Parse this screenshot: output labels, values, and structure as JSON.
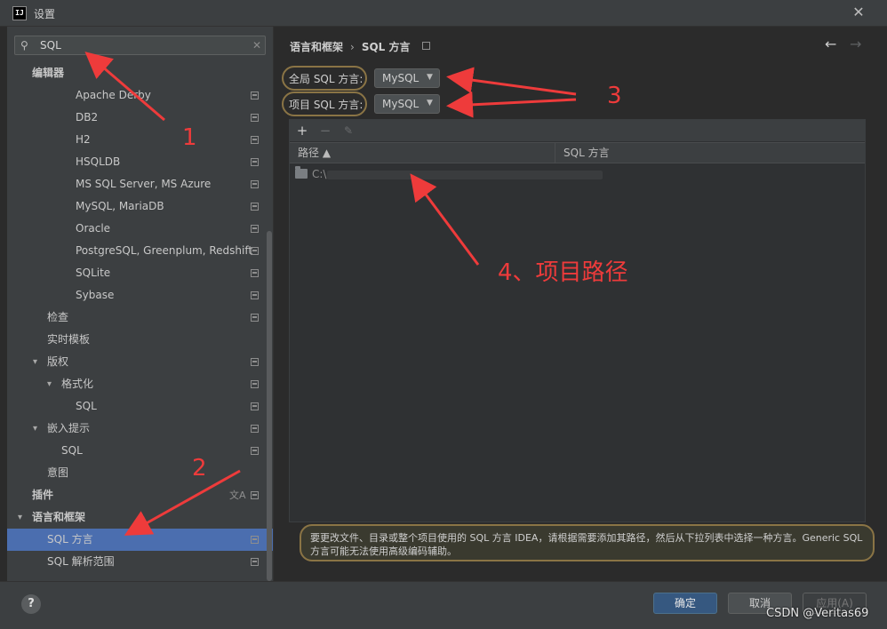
{
  "window": {
    "title": "设置",
    "app_icon_text": "IJ"
  },
  "search": {
    "value": "SQL"
  },
  "tree": [
    {
      "label": "编辑器",
      "indent": 28,
      "bold": true
    },
    {
      "label": "Apache Derby",
      "indent": 77,
      "project": true
    },
    {
      "label": "DB2",
      "indent": 77,
      "project": true
    },
    {
      "label": "H2",
      "indent": 77,
      "project": true
    },
    {
      "label": "HSQLDB",
      "indent": 77,
      "project": true
    },
    {
      "label": "MS SQL Server, MS Azure",
      "indent": 77,
      "project": true
    },
    {
      "label": "MySQL, MariaDB",
      "indent": 77,
      "project": true
    },
    {
      "label": "Oracle",
      "indent": 77,
      "project": true
    },
    {
      "label": "PostgreSQL, Greenplum, Redshift",
      "indent": 77,
      "project": true
    },
    {
      "label": "SQLite",
      "indent": 77,
      "project": true
    },
    {
      "label": "Sybase",
      "indent": 77,
      "project": true
    },
    {
      "label": "检查",
      "indent": 45,
      "project": true
    },
    {
      "label": "实时模板",
      "indent": 45
    },
    {
      "label": "版权",
      "indent": 45,
      "chevron": true,
      "project": true
    },
    {
      "label": "格式化",
      "indent": 61,
      "chevron": true,
      "project": true
    },
    {
      "label": "SQL",
      "indent": 77,
      "project": true
    },
    {
      "label": "嵌入提示",
      "indent": 45,
      "chevron": true,
      "project": true
    },
    {
      "label": "SQL",
      "indent": 61,
      "project": true
    },
    {
      "label": "意图",
      "indent": 45
    },
    {
      "label": "插件",
      "indent": 28,
      "bold": true,
      "project": true,
      "translate": true
    },
    {
      "label": "语言和框架",
      "indent": 28,
      "bold": true,
      "chevron": true
    },
    {
      "label": "SQL 方言",
      "indent": 45,
      "project": true,
      "selected": true
    },
    {
      "label": "SQL 解析范围",
      "indent": 45,
      "project": true
    }
  ],
  "breadcrumb": {
    "parent": "语言和框架",
    "separator": "›",
    "current": "SQL 方言"
  },
  "dialects": {
    "global_label": "全局 SQL 方言:",
    "global_value": "MySQL",
    "project_label": "项目 SQL 方言:",
    "project_value": "MySQL"
  },
  "table": {
    "toolbar": {
      "add": "+",
      "remove": "−",
      "edit": "✎"
    },
    "columns": [
      "路径 ▲",
      "SQL 方言"
    ],
    "rows": [
      {
        "path": "C:\\"
      }
    ]
  },
  "info": "要更改文件、目录或整个项目使用的 SQL 方言 IDEA，请根据需要添加其路径，然后从下拉列表中选择一种方言。Generic SQL 方言可能无法使用高级编码辅助。",
  "buttons": {
    "help": "?",
    "ok": "确定",
    "cancel": "取消",
    "apply": "应用(A)"
  },
  "annotations": {
    "n1": "1",
    "n2": "2",
    "n3": "3",
    "n4": "4、项目路径"
  },
  "watermark": "CSDN @Veritas69",
  "colors": {
    "accent": "#4b6eaf",
    "annotation": "#ee3b3b",
    "highlight_ring": "#8a7445"
  }
}
